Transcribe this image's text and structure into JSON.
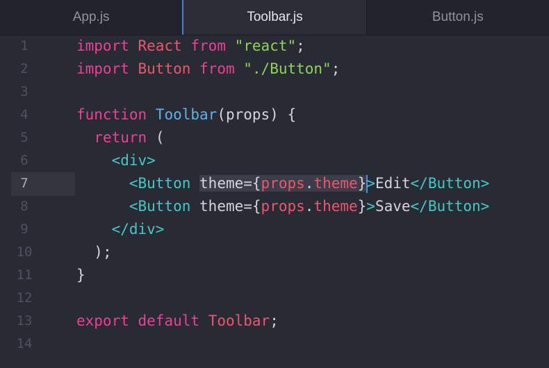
{
  "tabs": [
    {
      "label": "App.js",
      "active": false
    },
    {
      "label": "Toolbar.js",
      "active": true
    },
    {
      "label": "Button.js",
      "active": false
    }
  ],
  "line_numbers": [
    "1",
    "2",
    "3",
    "4",
    "5",
    "6",
    "7",
    "8",
    "9",
    "10",
    "11",
    "12",
    "13",
    "14"
  ],
  "current_line": 7,
  "code": {
    "l1": {
      "kw1": "import",
      "id": "React",
      "kw2": "from",
      "str": "\"react\"",
      "end": ";"
    },
    "l2": {
      "kw1": "import",
      "id": "Button",
      "kw2": "from",
      "str": "\"./Button\"",
      "end": ";"
    },
    "l4": {
      "kw": "function",
      "fn": "Toolbar",
      "params": "(props) {"
    },
    "l5": {
      "kw": "return",
      "paren": "("
    },
    "l6": {
      "tag": "<div>"
    },
    "l7": {
      "open": "<Button",
      "attr": "theme=",
      "brace_open": "{",
      "expr_obj": "props",
      "dot": ".",
      "expr_prop": "theme",
      "brace_close": "}",
      "gt": ">",
      "text": "Edit",
      "close": "</Button>"
    },
    "l8": {
      "open": "<Button",
      "attr": "theme=",
      "brace_open": "{",
      "expr_obj": "props",
      "dot": ".",
      "expr_prop": "theme",
      "brace_close": "}",
      "gt": ">",
      "text": "Save",
      "close": "</Button>"
    },
    "l9": {
      "tag": "</div>"
    },
    "l10": {
      "text": ");"
    },
    "l11": {
      "text": "}"
    },
    "l13": {
      "kw1": "export",
      "kw2": "default",
      "id": "Toolbar",
      "end": ";"
    }
  },
  "colors": {
    "background": "#282a34",
    "keyword": "#ee3f9b",
    "identifier": "#f0566b",
    "function": "#5fb3e6",
    "string": "#8fd655",
    "tag": "#44c8c8",
    "cursor": "#4e8cf0"
  }
}
